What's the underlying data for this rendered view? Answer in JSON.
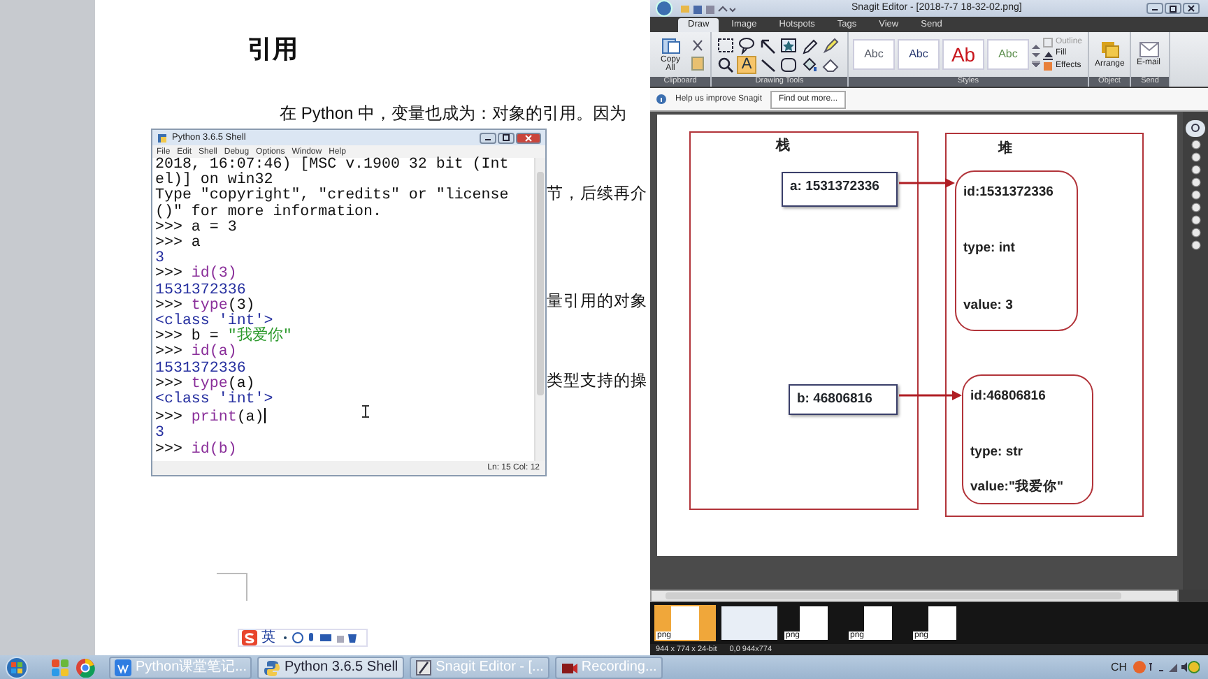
{
  "document": {
    "heading": "引用",
    "paragraph": "在 Python 中，变量也成为：对象的引用。因为",
    "fragments": [
      "节，后续再介",
      "量引用的对象",
      "类型支持的操"
    ]
  },
  "ime_toolbar": {
    "mode": "英"
  },
  "python_shell": {
    "title": "Python 3.6.5 Shell",
    "menu": [
      "File",
      "Edit",
      "Shell",
      "Debug",
      "Options",
      "Window",
      "Help"
    ],
    "lines": [
      {
        "parts": [
          {
            "text": "2018, 16:07:46) [MSC v.1900 32 bit (Int",
            "kind": "plain"
          }
        ]
      },
      {
        "parts": [
          {
            "text": "el)] on win32",
            "kind": "plain"
          }
        ]
      },
      {
        "parts": [
          {
            "text": "Type \"copyright\", \"credits\" or \"license",
            "kind": "plain"
          }
        ]
      },
      {
        "parts": [
          {
            "text": "()\" for more information.",
            "kind": "plain"
          }
        ]
      },
      {
        "parts": [
          {
            "text": ">>> a = 3",
            "kind": "plain"
          }
        ]
      },
      {
        "parts": [
          {
            "text": ">>> a",
            "kind": "plain"
          }
        ]
      },
      {
        "parts": [
          {
            "text": "3",
            "kind": "output"
          }
        ]
      },
      {
        "parts": [
          {
            "text": ">>> ",
            "kind": "plain"
          },
          {
            "text": "id(3)",
            "kind": "builtin"
          }
        ]
      },
      {
        "parts": [
          {
            "text": "1531372336",
            "kind": "output"
          }
        ]
      },
      {
        "parts": [
          {
            "text": ">>> ",
            "kind": "plain"
          },
          {
            "text": "type",
            "kind": "builtin"
          },
          {
            "text": "(3)",
            "kind": "plain"
          }
        ]
      },
      {
        "parts": [
          {
            "text": "<class 'int'>",
            "kind": "output"
          }
        ]
      },
      {
        "parts": [
          {
            "text": ">>> b = ",
            "kind": "plain"
          },
          {
            "text": "\"我爱你\"",
            "kind": "string"
          }
        ]
      },
      {
        "parts": [
          {
            "text": ">>> ",
            "kind": "plain"
          },
          {
            "text": "id(a)",
            "kind": "builtin"
          }
        ]
      },
      {
        "parts": [
          {
            "text": "1531372336",
            "kind": "output"
          }
        ]
      },
      {
        "parts": [
          {
            "text": ">>> ",
            "kind": "plain"
          },
          {
            "text": "type",
            "kind": "builtin"
          },
          {
            "text": "(a)",
            "kind": "plain"
          }
        ]
      },
      {
        "parts": [
          {
            "text": "<class 'int'>",
            "kind": "output"
          }
        ]
      },
      {
        "parts": [
          {
            "text": ">>> ",
            "kind": "plain"
          },
          {
            "text": "print",
            "kind": "builtin"
          },
          {
            "text": "(a)",
            "kind": "plain"
          }
        ],
        "cursor": true
      },
      {
        "parts": [
          {
            "text": "3",
            "kind": "output"
          }
        ]
      },
      {
        "parts": [
          {
            "text": ">>> ",
            "kind": "plain"
          },
          {
            "text": "id(b)",
            "kind": "builtin"
          }
        ]
      }
    ],
    "status": "Ln: 15  Col: 12"
  },
  "snagit": {
    "title": "Snagit Editor - [2018-7-7 18-32-02.png]",
    "tabs": [
      {
        "label": "Draw",
        "selected": true
      },
      {
        "label": "Image",
        "selected": false
      },
      {
        "label": "Hotspots",
        "selected": false
      },
      {
        "label": "Tags",
        "selected": false
      },
      {
        "label": "View",
        "selected": false
      },
      {
        "label": "Send",
        "selected": false
      }
    ],
    "ribbon": {
      "copy_all": "Copy All",
      "tools": [
        {
          "kind": "selection",
          "selected": false
        },
        {
          "kind": "callout",
          "selected": false
        },
        {
          "kind": "arrow",
          "selected": false
        },
        {
          "kind": "stamp",
          "selected": false
        },
        {
          "kind": "pen",
          "selected": false
        },
        {
          "kind": "highlighter",
          "selected": false
        },
        {
          "kind": "zoom",
          "selected": false
        },
        {
          "kind": "text",
          "label": "A",
          "selected": true
        },
        {
          "kind": "line",
          "selected": false
        },
        {
          "kind": "shape",
          "selected": false
        },
        {
          "kind": "fill",
          "selected": false
        },
        {
          "kind": "eraser",
          "selected": false
        }
      ],
      "styles": [
        {
          "label": "Abc",
          "color": "#555a66"
        },
        {
          "label": "Abc",
          "color": "#26366e"
        },
        {
          "label": "Ab",
          "color": "#c8161d"
        },
        {
          "label": "Abc",
          "color": "#5d8f4e"
        }
      ],
      "style_options": [
        {
          "label": "Outline",
          "disabled": true
        },
        {
          "label": "Fill",
          "disabled": false
        },
        {
          "label": "Effects",
          "disabled": false
        }
      ],
      "arrange": "Arrange",
      "email": "E-mail",
      "groups": [
        "Clipboard",
        "Drawing Tools",
        "Styles",
        "Object",
        "Send"
      ]
    },
    "message_bar": {
      "text": "Help us improve Snagit",
      "button": "Find out more..."
    },
    "diagram": {
      "stack": {
        "label": "栈",
        "variables": [
          "a: 1531372336",
          "b: 46806816"
        ]
      },
      "heap": {
        "label": "堆",
        "objects": [
          {
            "lines": [
              "id:1531372336",
              "type: int",
              "value:  3"
            ]
          },
          {
            "lines": [
              "id:46806816",
              "type: str",
              "value:\"我爱你\""
            ]
          }
        ]
      }
    },
    "thumbnails": [
      {
        "label": "png",
        "selected": true
      },
      {
        "selected": false
      },
      {
        "label": "png",
        "selected": false
      },
      {
        "label": "png",
        "selected": false
      },
      {
        "label": "png",
        "selected": false
      }
    ],
    "status": [
      "944 x 774 x 24-bit",
      "0,0  944x774"
    ]
  },
  "taskbar": {
    "tasks": [
      {
        "label": "Python课堂笔记...",
        "kind": "document",
        "selected": false
      },
      {
        "label": "Python 3.6.5 Shell",
        "kind": "python",
        "selected": true
      },
      {
        "label": "Snagit Editor - [...",
        "kind": "snagit",
        "selected": false
      },
      {
        "label": "Recording...",
        "kind": "recorder",
        "selected": false
      }
    ],
    "tray": "CH"
  }
}
